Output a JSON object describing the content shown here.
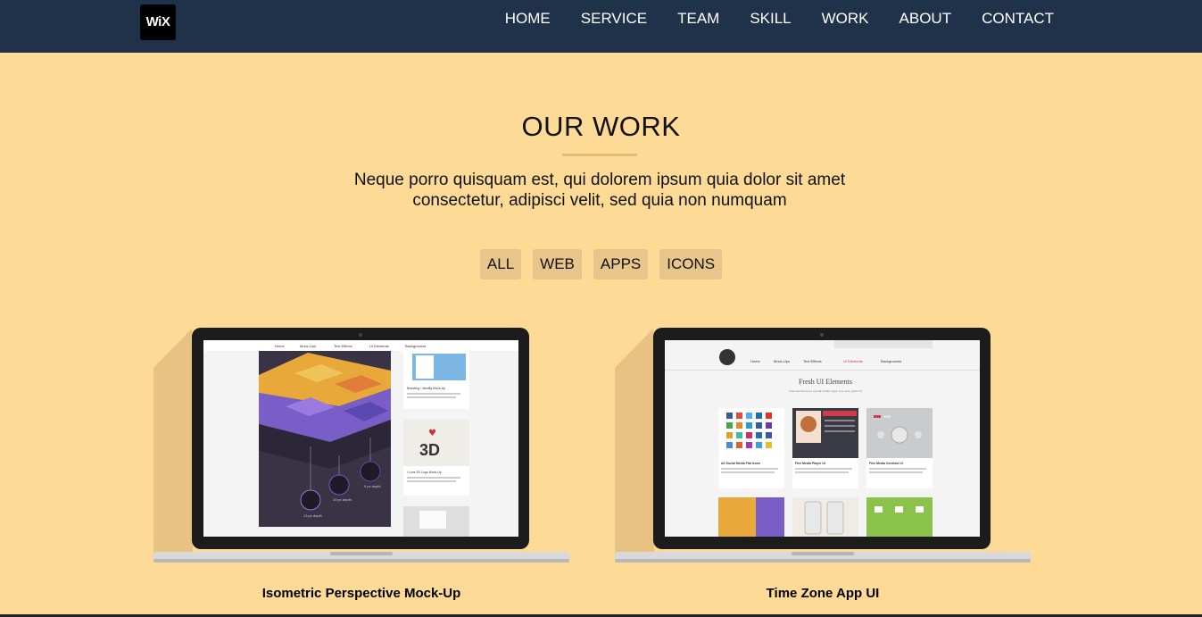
{
  "nav": {
    "logo": "WiX",
    "links": [
      "HOME",
      "SERVICE",
      "TEAM",
      "SKILL",
      "WORK",
      "ABOUT",
      "CONTACT"
    ]
  },
  "section": {
    "title": "OUR WORK",
    "description": "Neque porro quisquam est, qui dolorem ipsum quia dolor sit amet consectetur, adipisci velit, sed quia non numquam"
  },
  "filters": [
    "ALL",
    "WEB",
    "APPS",
    "ICONS"
  ],
  "works": [
    {
      "caption": "Isometric Perspective Mock-Up",
      "screen_nav": [
        "Home",
        "Mock-Ups",
        "Text Effects",
        "UI Elements",
        "Backgrounds"
      ],
      "side_cards": [
        "Branding / Identity Mock-Up",
        "I Love 3D Logo Mock-Up"
      ],
      "depth_labels": [
        "13 px depth",
        "10 px depth",
        "9 px depth"
      ]
    },
    {
      "caption": "Time Zone App UI",
      "screen_nav": [
        "Home",
        "Mock-Ups",
        "Text Effects",
        "UI Elements",
        "Backgrounds"
      ],
      "screen_title": "Fresh UI Elements",
      "screen_subtitle": "User interfaces for web & mobile apps, icon sets, game UI",
      "cards": [
        "All Social Media Flat Icons",
        "Flex Media Player UI",
        "Flex Media Controls UI"
      ]
    }
  ],
  "colors": {
    "navbar": "#1f3249",
    "background": "#fddb97",
    "filter_bg": "#e8c58a",
    "underline": "#e3bd75"
  }
}
